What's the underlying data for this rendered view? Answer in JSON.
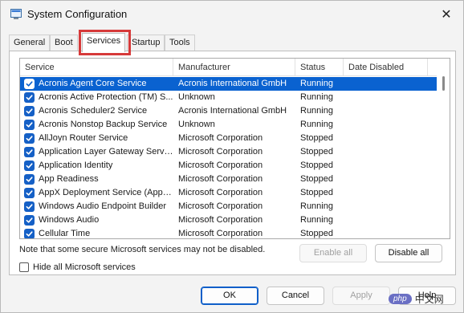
{
  "window": {
    "title": "System Configuration",
    "close_glyph": "✕"
  },
  "tabs": [
    {
      "label": "General"
    },
    {
      "label": "Boot"
    },
    {
      "label": "Services"
    },
    {
      "label": "Startup"
    },
    {
      "label": "Tools"
    }
  ],
  "active_tab": "Services",
  "highlight_color": "#d63a3a",
  "list": {
    "columns": [
      "Service",
      "Manufacturer",
      "Status",
      "Date Disabled"
    ],
    "rows": [
      {
        "service": "Acronis Agent Core Service",
        "manufacturer": "Acronis International GmbH",
        "status": "Running",
        "date_disabled": "",
        "checked": true,
        "selected": true
      },
      {
        "service": "Acronis Active Protection (TM) S...",
        "manufacturer": "Unknown",
        "status": "Running",
        "date_disabled": "",
        "checked": true
      },
      {
        "service": "Acronis Scheduler2 Service",
        "manufacturer": "Acronis International GmbH",
        "status": "Running",
        "date_disabled": "",
        "checked": true
      },
      {
        "service": "Acronis Nonstop Backup Service",
        "manufacturer": "Unknown",
        "status": "Running",
        "date_disabled": "",
        "checked": true
      },
      {
        "service": "AllJoyn Router Service",
        "manufacturer": "Microsoft Corporation",
        "status": "Stopped",
        "date_disabled": "",
        "checked": true
      },
      {
        "service": "Application Layer Gateway Service",
        "manufacturer": "Microsoft Corporation",
        "status": "Stopped",
        "date_disabled": "",
        "checked": true
      },
      {
        "service": "Application Identity",
        "manufacturer": "Microsoft Corporation",
        "status": "Stopped",
        "date_disabled": "",
        "checked": true
      },
      {
        "service": "App Readiness",
        "manufacturer": "Microsoft Corporation",
        "status": "Stopped",
        "date_disabled": "",
        "checked": true
      },
      {
        "service": "AppX Deployment Service (AppX...",
        "manufacturer": "Microsoft Corporation",
        "status": "Stopped",
        "date_disabled": "",
        "checked": true
      },
      {
        "service": "Windows Audio Endpoint Builder",
        "manufacturer": "Microsoft Corporation",
        "status": "Running",
        "date_disabled": "",
        "checked": true
      },
      {
        "service": "Windows Audio",
        "manufacturer": "Microsoft Corporation",
        "status": "Running",
        "date_disabled": "",
        "checked": true
      },
      {
        "service": "Cellular Time",
        "manufacturer": "Microsoft Corporation",
        "status": "Stopped",
        "date_disabled": "",
        "checked": true
      }
    ]
  },
  "note": "Note that some secure Microsoft services may not be disabled.",
  "hide_ms_label": "Hide all Microsoft services",
  "hide_ms_checked": false,
  "buttons": {
    "enable_all": "Enable all",
    "disable_all": "Disable all",
    "ok": "OK",
    "cancel": "Cancel",
    "apply": "Apply",
    "help": "Help"
  },
  "watermark": {
    "badge": "php",
    "text": "中文网"
  }
}
